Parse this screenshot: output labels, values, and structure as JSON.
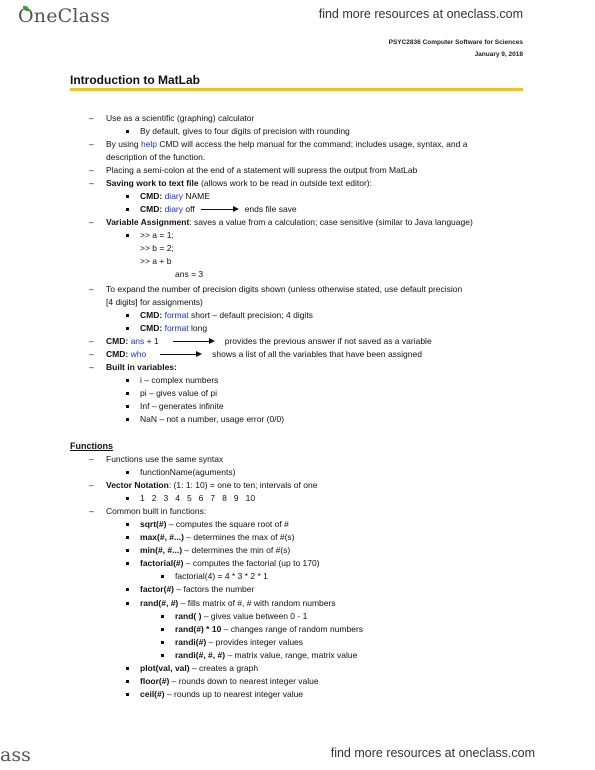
{
  "header": {
    "logo": "OneClass",
    "promo": "find more resources at oneclass.com",
    "course": "PSYC2836 Computer Software for Sciences",
    "date": "January 9, 2018"
  },
  "footer": {
    "logo_fragment": "ass",
    "promo": "find more resources at oneclass.com"
  },
  "document": {
    "title": "Introduction to MatLab",
    "section_functions": "Functions",
    "lines": {
      "l1": "Use as a scientific (graphing) calculator",
      "l1a": "By default, gives to four digits of precision with rounding",
      "l2_pre": "By using ",
      "l2_kw": "help",
      "l2_post": " CMD will access the help manual for the command; includes usage, syntax, and a",
      "l2_cont": "description of the function.",
      "l3": "Placing a semi-colon at the end of a statement will supress the output from MatLab",
      "l4_bold": "Saving work to text file",
      "l4_rest": " (allows work to be read in outside text editor):",
      "cmd": "CMD:",
      "diary": "diary",
      "diary_name": " NAME",
      "diary_off": " off",
      "ends_file": "ends file save",
      "l5_bold": "Variable Assignment",
      "l5_rest": ": saves a value from a calculation; case sensitive (similar to Java language)",
      "code1": ">> a = 1;",
      "code2": ">> b = 2;",
      "code3": ">> a + b",
      "code4": "ans = 3",
      "l6": "To expand the number of precision digits shown (unless otherwise stated, use default precision",
      "l6_cont": "[4 digits] for assignments)",
      "format": "format",
      "format_short": " short – default precision; 4 digits",
      "format_long": " long",
      "ans_kw": "ans",
      "ans_rest": " + 1",
      "ans_desc": "provides the previous answer if not saved as a variable",
      "who_kw": "who",
      "who_desc": "shows a list of all the variables that have been assigned",
      "builtin": "Built in variables:",
      "bv1": "i – complex numbers",
      "bv2": "pi – gives value of pi",
      "bv3": "Inf – generates infinite",
      "bv4": "NaN – not a number, usage error (0/0)",
      "f1": "Functions use the same syntax",
      "f1a": "functionName(aguments)",
      "f2_bold": "Vector Notation",
      "f2_rest": ": (1: 1: 10) = one to ten; intervals of one",
      "vector": [
        "1",
        "2",
        "3",
        "4",
        "5",
        "6",
        "7",
        "8",
        "9",
        "10"
      ],
      "f3": "Common built in functions:",
      "sqrt_b": "sqrt(#)",
      "sqrt_r": " – computes the square root of #",
      "max_b": "max(#, #...)",
      "max_r": " – determines the max of #(s)",
      "min_b": "min(#, #...)",
      "min_r": " – determines the min of #(s)",
      "fact_b": "factorial(#)",
      "fact_r": " – computes the factorial (up to 170)",
      "fact_ex": "factorial(4) = 4 * 3 * 2 * 1",
      "factor_b": "factor(#)",
      "factor_r": " – factors the number",
      "rand_b": "rand(#, #)",
      "rand_r": " – fills matrix of #, # with random numbers",
      "rand0_b": "rand( )",
      "rand0_r": " – gives value between 0 - 1",
      "rand10_b": "rand(#) * 10",
      "rand10_r": " – changes range of random numbers",
      "randi_b": "randi(#)",
      "randi_r": " – provides integer values",
      "randi3_b": "randi(#, #, #)",
      "randi3_r": " – matrix value, range, matrix value",
      "plot_b": "plot(val, val)",
      "plot_r": " – creates a graph",
      "floor_b": "floor(#)",
      "floor_r": " – rounds down to nearest integer value",
      "ceil_b": "ceil(#)",
      "ceil_r": " – rounds up to nearest integer value"
    }
  },
  "colors": {
    "accent_rule": "#f2c12e",
    "keyword_blue": "#1f2fcf"
  }
}
